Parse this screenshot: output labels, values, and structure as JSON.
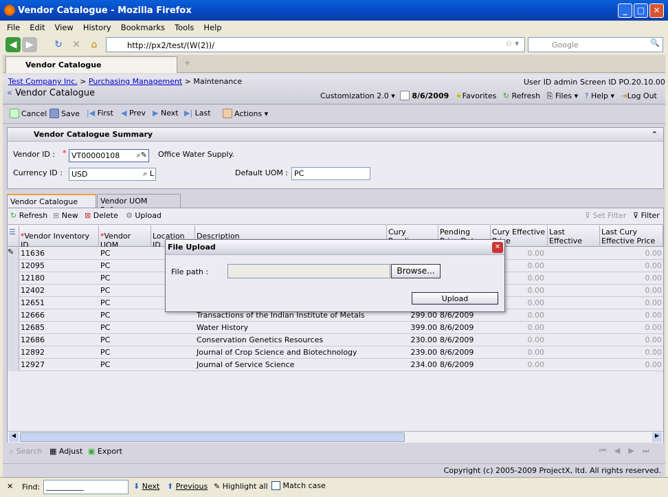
{
  "window": {
    "title": "Vendor Catalogue - Mozilla Firefox"
  },
  "menu": [
    "File",
    "Edit",
    "View",
    "History",
    "Bookmarks",
    "Tools",
    "Help"
  ],
  "nav": {
    "url": "http://px2/test/(W(2))/",
    "search_placeholder": "Google"
  },
  "browser_tab": {
    "label": "Vendor Catalogue"
  },
  "breadcrumb": {
    "company": "Test Company Inc.",
    "module": "Purchasing Management",
    "section": "Maintenance"
  },
  "header": {
    "title": "Vendor Catalogue",
    "user": "User ID admin",
    "screen": "Screen ID PO.20.10.00",
    "customization": "Customization 2.0",
    "date": "8/6/2009",
    "favorites": "Favorites",
    "refresh": "Refresh",
    "files": "Files",
    "help": "Help",
    "logout": "Log Out"
  },
  "toolbar": {
    "cancel": "Cancel",
    "save": "Save",
    "first": "First",
    "prev": "Prev",
    "next": "Next",
    "last": "Last",
    "actions": "Actions"
  },
  "summary": {
    "title": "Vendor Catalogue Summary",
    "vendor_label": "Vendor ID :",
    "vendor_value": "VT00000108",
    "vendor_name": "Office Water Supply.",
    "currency_label": "Currency ID :",
    "currency_value": "USD",
    "uom_label": "Default UOM :",
    "uom_value": "PC"
  },
  "tabs": [
    "Vendor Catalogue Details",
    "Vendor UOM Reference"
  ],
  "grid_toolbar": {
    "refresh": "Refresh",
    "new": "New",
    "delete": "Delete",
    "upload": "Upload",
    "set_filter": "Set Filter",
    "filter": "Filter"
  },
  "columns": [
    "Vendor Inventory ID",
    "Vendor UOM",
    "Location ID",
    "Description",
    "Cury Pending Price",
    "Pending Price Date",
    "Cury Effective Price",
    "Last Effective Date",
    "Last Cury Effective Price"
  ],
  "rows": [
    {
      "id": "11636",
      "uom": "PC",
      "desc": "",
      "pend": "",
      "date": "",
      "eff": "0.00",
      "last": "0.00"
    },
    {
      "id": "12095",
      "uom": "PC",
      "desc": "",
      "pend": "",
      "date": "",
      "eff": "0.00",
      "last": "0.00"
    },
    {
      "id": "12180",
      "uom": "PC",
      "desc": "",
      "pend": "",
      "date": "",
      "eff": "0.00",
      "last": "0.00"
    },
    {
      "id": "12402",
      "uom": "PC",
      "desc": "",
      "pend": "",
      "date": "",
      "eff": "0.00",
      "last": "0.00"
    },
    {
      "id": "12651",
      "uom": "PC",
      "desc": "",
      "pend": "",
      "date": "",
      "eff": "0.00",
      "last": "0.00"
    },
    {
      "id": "12666",
      "uom": "PC",
      "desc": "Transactions of the Indian Institute of Metals",
      "pend": "299.00",
      "date": "8/6/2009",
      "eff": "0.00",
      "last": "0.00"
    },
    {
      "id": "12685",
      "uom": "PC",
      "desc": "Water History",
      "pend": "399.00",
      "date": "8/6/2009",
      "eff": "0.00",
      "last": "0.00"
    },
    {
      "id": "12686",
      "uom": "PC",
      "desc": "Conservation Genetics Resources",
      "pend": "230.00",
      "date": "8/6/2009",
      "eff": "0.00",
      "last": "0.00"
    },
    {
      "id": "12892",
      "uom": "PC",
      "desc": "Journal of Crop Science and Biotechnology",
      "pend": "239.00",
      "date": "8/6/2009",
      "eff": "0.00",
      "last": "0.00"
    },
    {
      "id": "12927",
      "uom": "PC",
      "desc": "Journal of Service Science",
      "pend": "234.00",
      "date": "8/6/2009",
      "eff": "0.00",
      "last": "0.00"
    }
  ],
  "bottom": {
    "search": "Search",
    "adjust": "Adjust",
    "export": "Export"
  },
  "footer": "Copyright (c) 2005-2009 ProjectX, ltd. All rights reserved.",
  "dialog": {
    "title": "File Upload",
    "label": "File path :",
    "browse": "Browse...",
    "upload": "Upload"
  },
  "find": {
    "label": "Find:",
    "value": "__________",
    "next": "Next",
    "previous": "Previous",
    "highlight": "Highlight all",
    "match": "Match case"
  }
}
